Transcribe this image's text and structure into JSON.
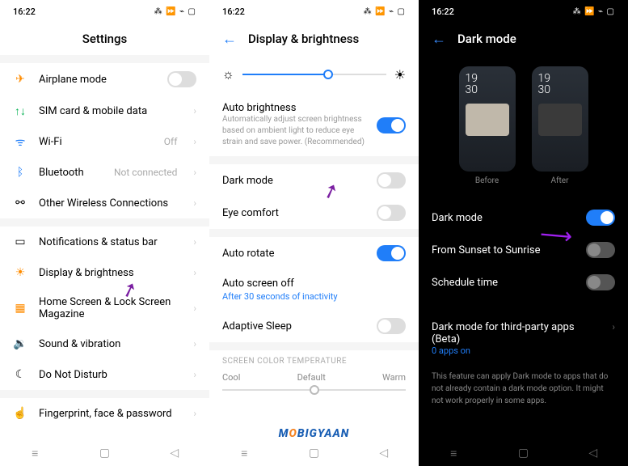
{
  "status": {
    "time": "16:22",
    "icons": "⁂ ⏩ ⌁ ▢"
  },
  "p1": {
    "title": "Settings",
    "items": [
      {
        "icon": "✈",
        "cls": "ic-orange",
        "label": "Airplane mode",
        "toggle": false
      },
      {
        "icon": "↑↓",
        "cls": "ic-green",
        "label": "SIM card & mobile data"
      },
      {
        "icon": "ᯤ",
        "cls": "ic-blue",
        "label": "Wi-Fi",
        "value": "Off"
      },
      {
        "icon": "ᛒ",
        "cls": "ic-blue",
        "label": "Bluetooth",
        "value": "Not connected"
      },
      {
        "icon": "⚯",
        "cls": "",
        "label": "Other Wireless Connections"
      }
    ],
    "items2": [
      {
        "icon": "▭",
        "cls": "",
        "label": "Notifications & status bar"
      },
      {
        "icon": "☀",
        "cls": "ic-orange",
        "label": "Display & brightness"
      },
      {
        "icon": "▦",
        "cls": "ic-orange",
        "label": "Home Screen & Lock Screen Magazine"
      },
      {
        "icon": "🔉",
        "cls": "ic-green",
        "label": "Sound & vibration"
      },
      {
        "icon": "☾",
        "cls": "",
        "label": "Do Not Disturb"
      }
    ],
    "items3": [
      {
        "icon": "☝",
        "cls": "",
        "label": "Fingerprint, face & password"
      }
    ]
  },
  "p2": {
    "title": "Display & brightness",
    "auto": {
      "label": "Auto brightness",
      "desc": "Automatically adjust screen brightness based on ambient light to reduce eye strain and save power. (Recommended)"
    },
    "dark": "Dark mode",
    "eye": "Eye comfort",
    "rotate": "Auto rotate",
    "off": {
      "label": "Auto screen off",
      "sub": "After 30 seconds of inactivity"
    },
    "adaptive": "Adaptive Sleep",
    "temp": {
      "title": "SCREEN COLOR TEMPERATURE",
      "cool": "Cool",
      "default": "Default",
      "warm": "Warm"
    }
  },
  "p3": {
    "title": "Dark mode",
    "preview": {
      "time": "19\n30",
      "before": "Before",
      "after": "After"
    },
    "dark": "Dark mode",
    "sunset": "From Sunset to Sunrise",
    "schedule": "Schedule time",
    "beta": {
      "label": "Dark mode for third-party apps (Beta)",
      "sub": "0 apps on"
    },
    "note": "This feature can apply Dark mode to apps that do not already contain a dark mode option. It might not work properly in some apps."
  },
  "watermark": {
    "m": "M",
    "o": "O",
    "rest": "BIGYAAN"
  }
}
